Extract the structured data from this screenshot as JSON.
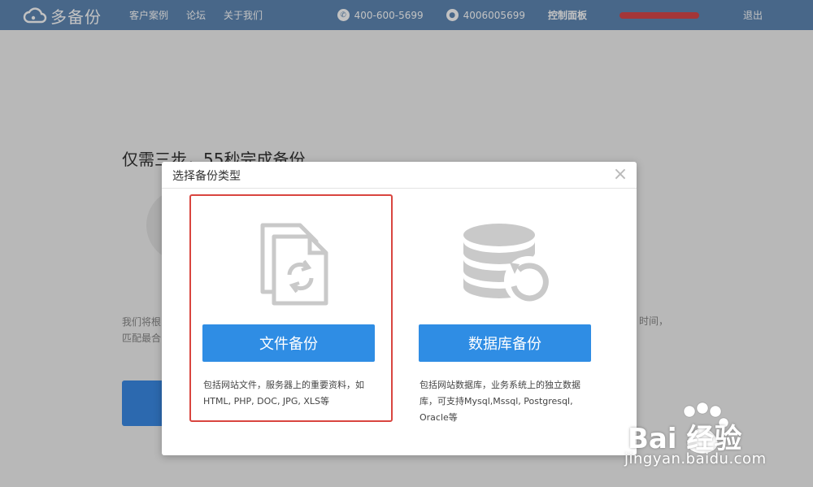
{
  "nav": {
    "logo_text": "多备份",
    "links": [
      "客户案例",
      "论坛",
      "关于我们"
    ],
    "phone": "400-600-5699",
    "qq": "4006005699",
    "dashboard": "控制面板",
    "logout": "退出"
  },
  "background": {
    "title": "仅需三步，55秒完成备份",
    "text_line1": "我们将根",
    "text_line2": "匹配最合",
    "text_right": "时间，"
  },
  "modal": {
    "title": "选择备份类型",
    "close_glyph": "×",
    "options": [
      {
        "label": "文件备份",
        "desc": "包括网站文件，服务器上的重要资料，如HTML, PHP, DOC, JPG, XLS等",
        "selected": true
      },
      {
        "label": "数据库备份",
        "desc": "包括网站数据库，业务系统上的独立数据库，可支持Mysql,Mssql, Postgresql, Oracle等",
        "selected": false
      }
    ]
  },
  "watermark": {
    "brand_text": "Bai 经验",
    "url": "jingyan.baidu.com"
  },
  "colors": {
    "nav_bg": "#5f88b4",
    "button_blue": "#2f8de4",
    "highlight_red": "#d9453f"
  },
  "icons": {
    "file_option": "file-sync-icon",
    "db_option": "database-restore-icon"
  }
}
